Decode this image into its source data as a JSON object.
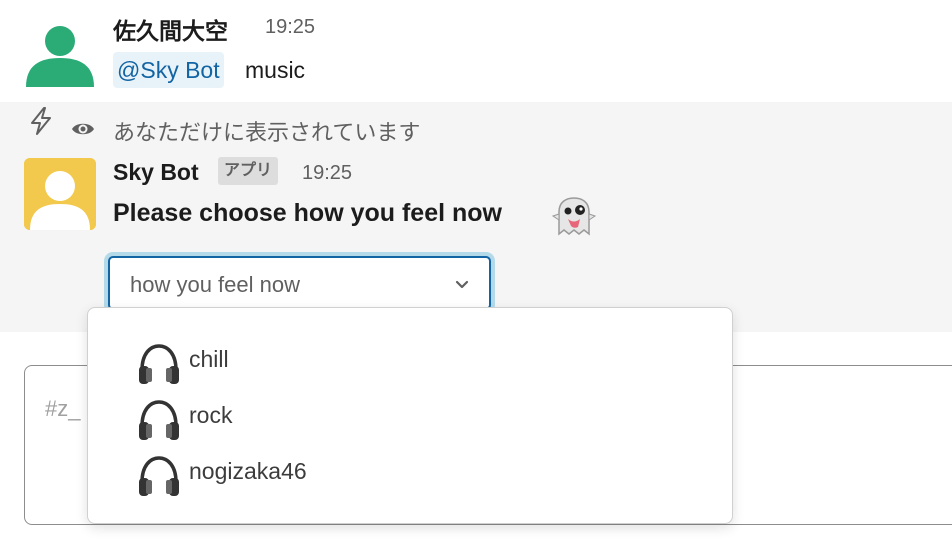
{
  "message1": {
    "author": "佐久間大空",
    "time": "19:25",
    "mention": "@Sky Bot",
    "text": "music",
    "avatar_icon": "user-avatar-icon"
  },
  "ephemeral": {
    "notice": "あなただけに表示されています",
    "eye_icon": "eye-icon"
  },
  "bot_message": {
    "author": "Sky Bot",
    "badge": "アプリ",
    "time": "19:25",
    "text": "Please choose how you feel now",
    "emoji": "ghost-emoji"
  },
  "select": {
    "value": "how you feel now",
    "options": [
      {
        "label": "chill",
        "icon": "headphones-icon"
      },
      {
        "label": "rock",
        "icon": "headphones-icon"
      },
      {
        "label": "nogizaka46",
        "icon": "headphones-icon"
      }
    ]
  },
  "composer": {
    "placeholder": "#z_",
    "shortcut_icon": "lightning-bolt-icon"
  },
  "colors": {
    "mention_bg": "#e8f3f9",
    "mention_fg": "#1264a3",
    "accent": "#1264a3",
    "avatar1": "#2bac76",
    "avatar2": "#f2c94c"
  }
}
